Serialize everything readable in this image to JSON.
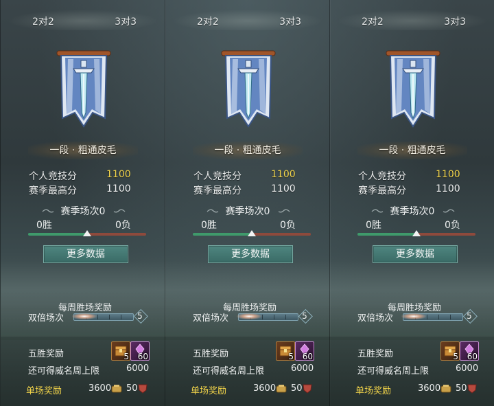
{
  "panels": [
    {
      "tabs": [
        "2对2",
        "3对3"
      ],
      "rank_title": "一段 · 粗通皮毛",
      "personal_score_label": "个人竞技分",
      "personal_score_value": "1100",
      "season_best_label": "赛季最高分",
      "season_best_value": "1100",
      "season_matches": "赛季场次0",
      "wins": "0胜",
      "losses": "0负",
      "win_ratio": 0.5,
      "more_data_button": "更多数据",
      "weekly_reward_title": "每周胜场奖励",
      "double_matches_label": "双倍场次",
      "double_matches_value": "5",
      "five_win_label": "五胜奖励",
      "five_win_items": [
        {
          "icon": "treasure-chest-icon",
          "count": "5"
        },
        {
          "icon": "purple-gem-icon",
          "count": "60"
        }
      ],
      "prestige_limit_label": "还可得威名周上限",
      "prestige_limit_value": "6000",
      "single_reward_label": "单场奖励",
      "single_reward_coin": "3600",
      "single_reward_shield": "50"
    },
    {
      "tabs": [
        "2对2",
        "3对3"
      ],
      "rank_title": "一段 · 粗通皮毛",
      "personal_score_label": "个人竞技分",
      "personal_score_value": "1100",
      "season_best_label": "赛季最高分",
      "season_best_value": "1100",
      "season_matches": "赛季场次0",
      "wins": "0胜",
      "losses": "0负",
      "win_ratio": 0.5,
      "more_data_button": "更多数据",
      "weekly_reward_title": "每周胜场奖励",
      "double_matches_label": "双倍场次",
      "double_matches_value": "5",
      "five_win_label": "五胜奖励",
      "five_win_items": [
        {
          "icon": "treasure-chest-icon",
          "count": "5"
        },
        {
          "icon": "purple-gem-icon",
          "count": "60"
        }
      ],
      "prestige_limit_label": "还可得威名周上限",
      "prestige_limit_value": "6000",
      "single_reward_label": "单场奖励",
      "single_reward_coin": "3600",
      "single_reward_shield": "50"
    },
    {
      "tabs": [
        "2对2",
        "3对3"
      ],
      "rank_title": "一段 · 粗通皮毛",
      "personal_score_label": "个人竞技分",
      "personal_score_value": "1100",
      "season_best_label": "赛季最高分",
      "season_best_value": "1100",
      "season_matches": "赛季场次0",
      "wins": "0胜",
      "losses": "0负",
      "win_ratio": 0.5,
      "more_data_button": "更多数据",
      "weekly_reward_title": "每周胜场奖励",
      "double_matches_label": "双倍场次",
      "double_matches_value": "5",
      "five_win_label": "五胜奖励",
      "five_win_items": [
        {
          "icon": "treasure-chest-icon",
          "count": "5"
        },
        {
          "icon": "purple-gem-icon",
          "count": "60"
        }
      ],
      "prestige_limit_label": "还可得威名周上限",
      "prestige_limit_value": "6000",
      "single_reward_label": "单场奖励",
      "single_reward_coin": "3600",
      "single_reward_shield": "50"
    }
  ],
  "colors": {
    "gold_text": "#f2d44a",
    "win_bar": "#3f9a6b",
    "loss_bar": "#8e4a3c",
    "button_bg": "#3f746e"
  }
}
